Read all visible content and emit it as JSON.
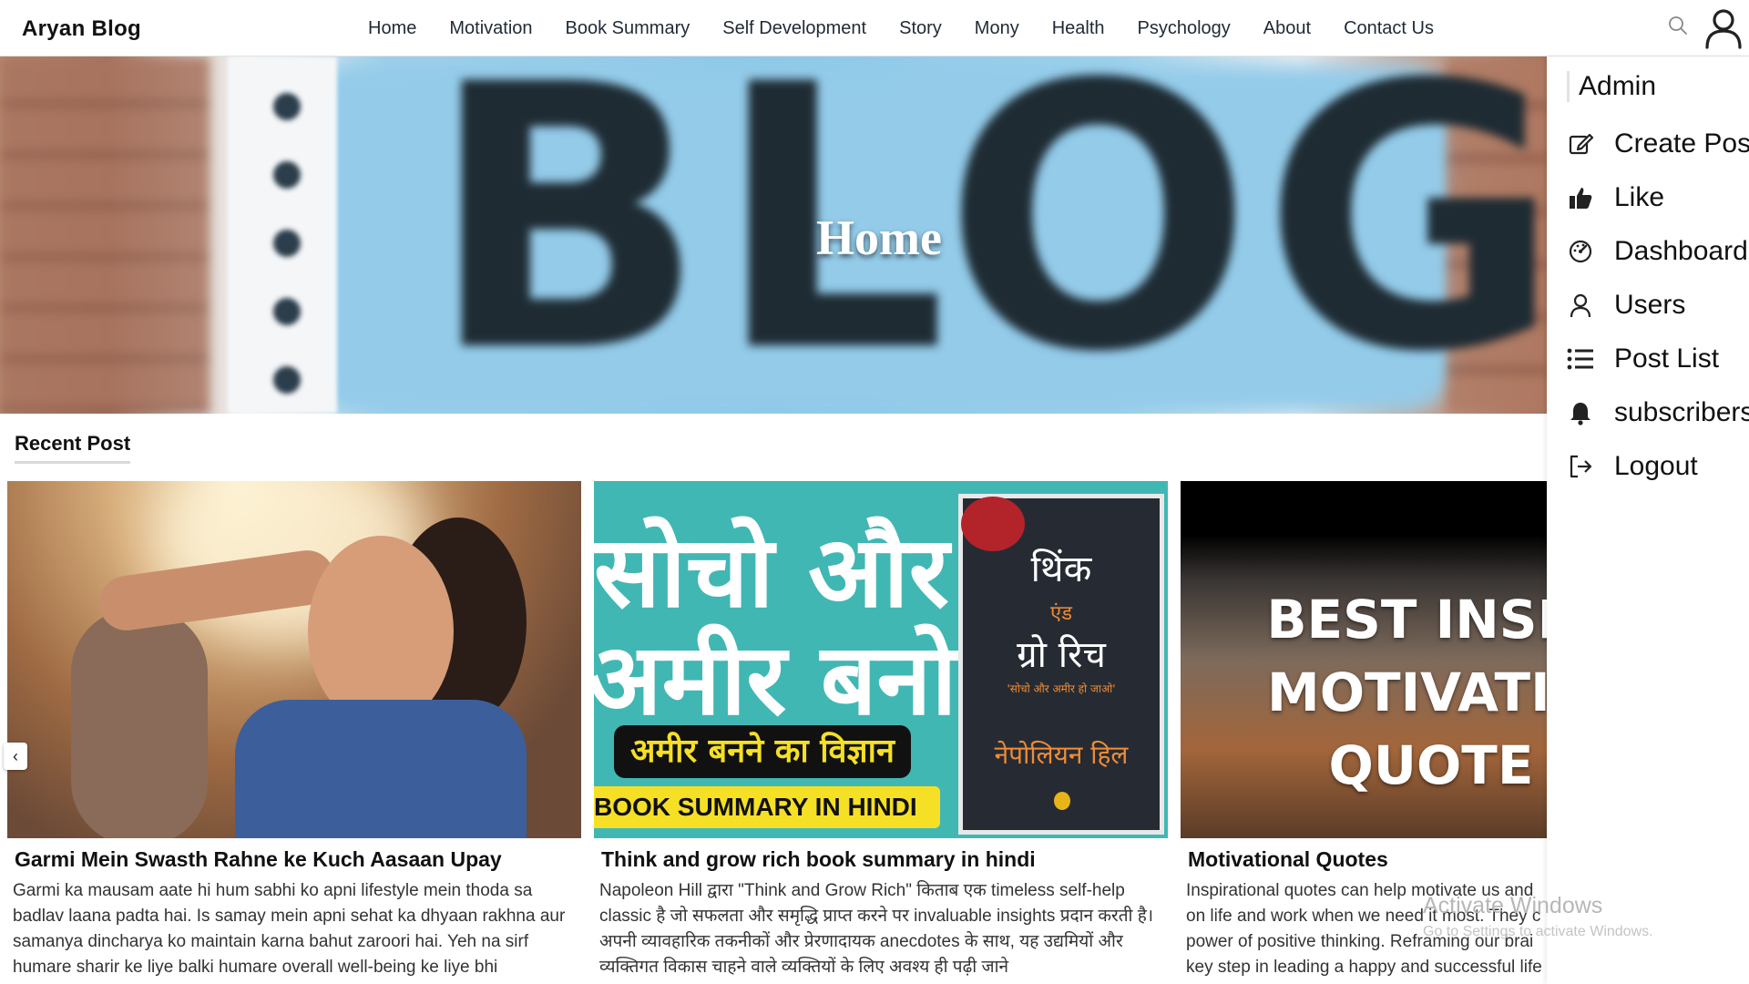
{
  "header": {
    "brand": "Aryan Blog",
    "nav": [
      "Home",
      "Motivation",
      "Book Summary",
      "Self Development",
      "Story",
      "Mony",
      "Health",
      "Psychology",
      "About",
      "Contact Us"
    ]
  },
  "hero": {
    "title": "Home",
    "background_word": "BLOG"
  },
  "recent": {
    "heading": "Recent Post",
    "posts": [
      {
        "title": "Garmi Mein Swasth Rahne ke Kuch Aasaan Upay",
        "excerpt": "Garmi ka mausam aate hi hum sabhi ko apni lifestyle mein thoda sa badlav laana padta hai. Is samay mein apni sehat ka dhyaan rakhna aur samanya dincharya ko maintain karna bahut zaroori hai. Yeh na sirf humare sharir ke liye balki humare overall well-being ke liye bhi"
      },
      {
        "title": "Think and grow rich book summary in hindi",
        "excerpt": "Napoleon Hill द्वारा \"Think and Grow Rich\" किताब एक timeless self-help classic है जो सफलता और समृद्धि प्राप्त करने पर invaluable insights प्रदान करती है। अपनी व्यावहारिक तकनीकों और प्रेरणादायक anecdotes के साथ, यह उद्यमियों और व्यक्तिगत विकास चाहने वाले व्यक्तियों के लिए अवश्य ही पढ़ी जाने",
        "image_text": {
          "line1": "सोचो और",
          "line2": "अमीर बनो",
          "pill": "अमीर बनने का विज्ञान",
          "strip": "BOOK SUMMARY IN HINDI",
          "book_title1": "थिंक",
          "book_title2": "एंड",
          "book_title3": "ग्रो रिच",
          "book_tagline": "'सोचो और अमीर हो जाओ'",
          "book_author": "नेपोलियन हिल"
        }
      },
      {
        "title": "Motivational Quotes",
        "excerpt": "Inspirational quotes can help motivate us and on life and work when we need it most. They c power of positive thinking. Reframing our brai key step in leading a happy and successful life",
        "image_text": [
          "BEST INSPI",
          "MOTIVATIO",
          "QUOTE"
        ]
      }
    ]
  },
  "dropdown": {
    "heading": "Admin",
    "items": [
      {
        "label": "Create Post",
        "icon": "edit-icon"
      },
      {
        "label": "Like",
        "icon": "thumbs-up-icon"
      },
      {
        "label": "Dashboard",
        "icon": "dashboard-icon"
      },
      {
        "label": "Users",
        "icon": "user-icon"
      },
      {
        "label": "Post List",
        "icon": "list-icon"
      },
      {
        "label": "subscribers",
        "icon": "bell-icon"
      },
      {
        "label": "Logout",
        "icon": "logout-icon"
      }
    ]
  },
  "watermark": {
    "line1": "Activate Windows",
    "line2": "Go to Settings to activate Windows."
  },
  "colors": {
    "accent_text": "#1f2a36",
    "hero_blue": "#93cbe9",
    "card2_teal": "#41b7b4",
    "card2_yellow": "#f5e025"
  }
}
